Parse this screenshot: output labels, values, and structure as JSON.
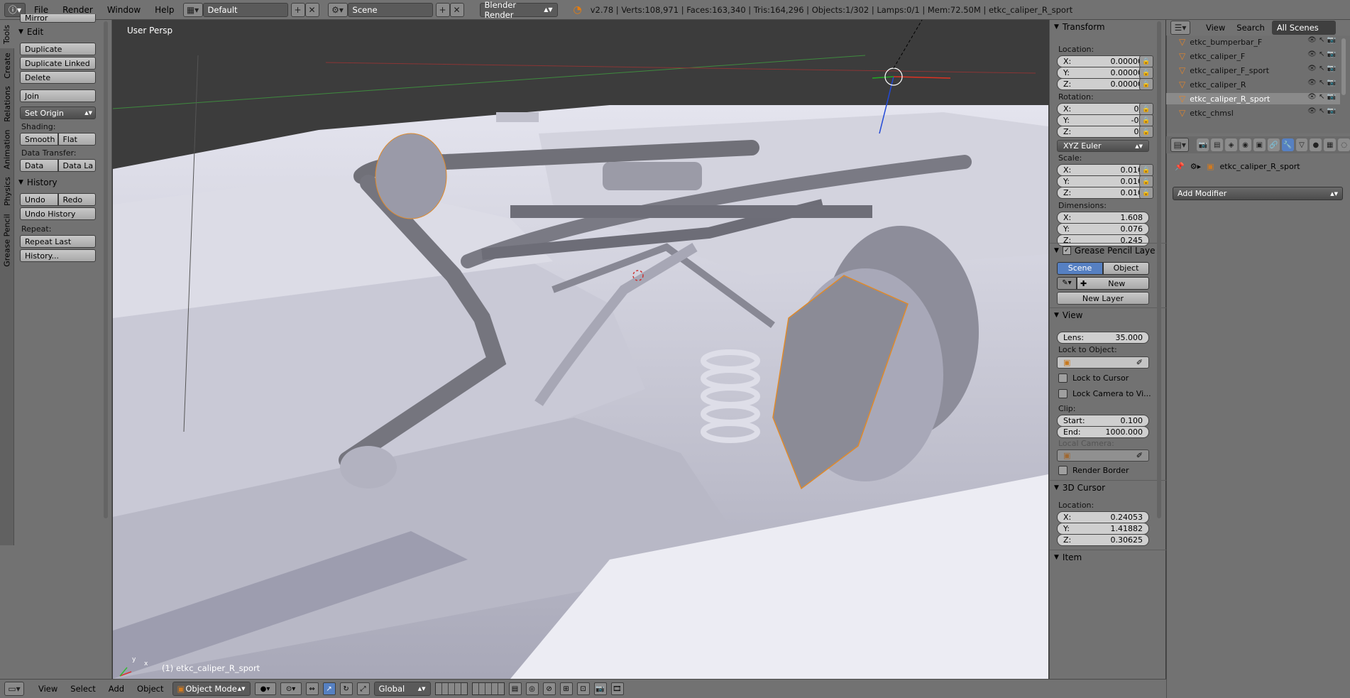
{
  "topbar": {
    "menus": [
      "File",
      "Render",
      "Window",
      "Help"
    ],
    "screen_layout": "Default",
    "scene": "Scene",
    "render_engine": "Blender Render",
    "status": "v2.78 | Verts:108,971 | Faces:163,340 | Tris:164,296 | Objects:1/302 | Lamps:0/1 | Mem:72.50M | etkc_caliper_R_sport"
  },
  "shelf": {
    "tabs": [
      "Tools",
      "Create",
      "Relations",
      "Animation",
      "Physics",
      "Grease Pencil"
    ],
    "mirror_label": "Mirror",
    "edit_header": "Edit",
    "duplicate": "Duplicate",
    "duplicate_linked": "Duplicate Linked",
    "delete": "Delete",
    "join": "Join",
    "set_origin": "Set Origin",
    "shading_label": "Shading:",
    "smooth": "Smooth",
    "flat": "Flat",
    "data_transfer_label": "Data Transfer:",
    "data": "Data",
    "data_layout": "Data La",
    "history_header": "History",
    "undo": "Undo",
    "redo": "Redo",
    "undo_history": "Undo History",
    "repeat_label": "Repeat:",
    "repeat_last": "Repeat Last",
    "history_more": "History..."
  },
  "viewport": {
    "view_name": "User Persp",
    "object_caption": "(1) etkc_caliper_R_sport",
    "axis_x": "x",
    "axis_y": "y"
  },
  "npanel": {
    "transform_header": "Transform",
    "location_label": "Location:",
    "loc": {
      "x_label": "X:",
      "x": "0.00000",
      "y_label": "Y:",
      "y": "0.00000",
      "z_label": "Z:",
      "z": "0.00000"
    },
    "rotation_label": "Rotation:",
    "rot": {
      "x": "0°",
      "y": "-0°",
      "z": "0°"
    },
    "rotation_mode": "XYZ Euler",
    "scale_label": "Scale:",
    "scale": {
      "x": "0.010",
      "y": "0.010",
      "z": "0.010"
    },
    "dimensions_label": "Dimensions:",
    "dim": {
      "x": "1.608",
      "y": "0.076",
      "z": "0.245"
    },
    "grease_header": "Grease Pencil Laye",
    "gp_scene": "Scene",
    "gp_object": "Object",
    "gp_new": "New",
    "gp_new_layer": "New Layer",
    "view_header": "View",
    "lens_label": "Lens:",
    "lens": "35.000",
    "lock_object_label": "Lock to Object:",
    "lock_cursor": "Lock to Cursor",
    "lock_camera": "Lock Camera to Vi...",
    "clip_label": "Clip:",
    "clip_start_label": "Start:",
    "clip_start": "0.100",
    "clip_end_label": "End:",
    "clip_end": "1000.000",
    "local_camera_label": "Local Camera:",
    "render_border": "Render Border",
    "cursor_header": "3D Cursor",
    "cursor_location_label": "Location:",
    "cursor": {
      "x": "0.24053",
      "y": "1.41882",
      "z": "0.30625"
    },
    "item_header": "Item"
  },
  "outliner": {
    "view": "View",
    "search": "Search",
    "filter": "All Scenes",
    "items": [
      "etkc_bumperbar_F",
      "etkc_caliper_F",
      "etkc_caliper_F_sport",
      "etkc_caliper_R",
      "etkc_caliper_R_sport",
      "etkc_chmsl"
    ]
  },
  "properties": {
    "object_name": "etkc_caliper_R_sport",
    "add_modifier": "Add Modifier"
  },
  "bottombar": {
    "menus": [
      "View",
      "Select",
      "Add",
      "Object"
    ],
    "mode": "Object Mode",
    "orientation": "Global"
  }
}
